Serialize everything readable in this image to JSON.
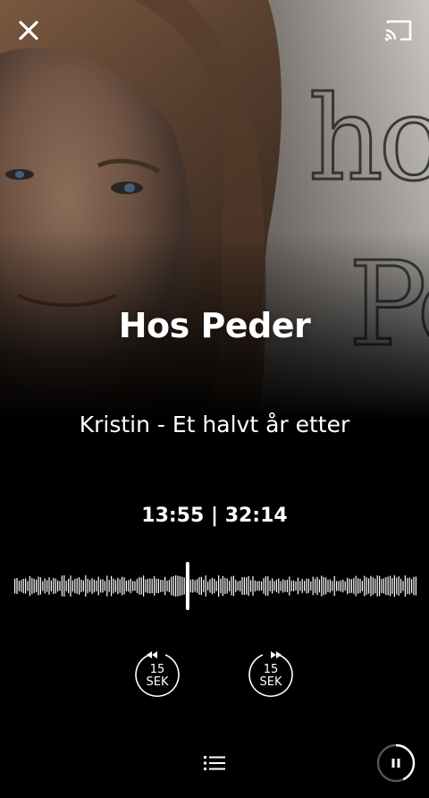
{
  "header": {
    "close_icon": "close-icon",
    "cast_icon": "cast-icon"
  },
  "cover": {
    "handwriting_text": "hos Peder"
  },
  "player": {
    "show_title": "Hos Peder",
    "episode_title": "Kristin - Et halvt år etter",
    "elapsed": "13:55",
    "separator": "|",
    "duration": "32:14",
    "progress_fraction": 0.431
  },
  "controls": {
    "skip_back": {
      "icon": "rewind-15-icon",
      "amount": "15",
      "unit": "SEK"
    },
    "skip_forward": {
      "icon": "forward-15-icon",
      "amount": "15",
      "unit": "SEK"
    },
    "playlist_icon": "playlist-icon",
    "pause_icon": "pause-icon"
  },
  "colors": {
    "background": "#000000",
    "text": "#ffffff",
    "waveform": "#ffffff"
  }
}
